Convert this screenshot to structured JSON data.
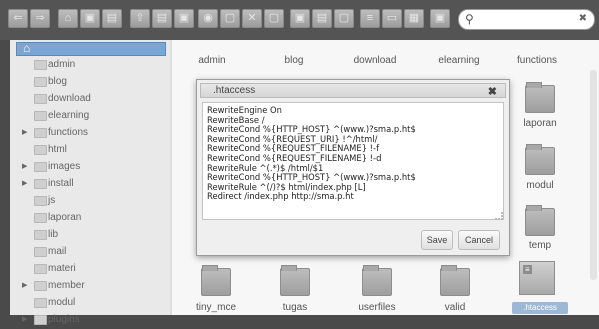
{
  "toolbar": {
    "buttons": [
      "back-icon",
      "forward-icon",
      "home-icon",
      "save-icon",
      "disk-icon",
      "upload-icon",
      "download-icon",
      "view-icon",
      "eye-icon",
      "cut-icon",
      "delete-icon",
      "rename-icon",
      "copy-icon",
      "paste-icon",
      "edit-icon",
      "settings-icon",
      "list-icon",
      "grid-icon",
      "info-icon"
    ],
    "search_value": ""
  },
  "sidebar": {
    "items": [
      {
        "label": "admin",
        "expandable": false
      },
      {
        "label": "blog",
        "expandable": false
      },
      {
        "label": "download",
        "expandable": false
      },
      {
        "label": "elearning",
        "expandable": false
      },
      {
        "label": "functions",
        "expandable": true
      },
      {
        "label": "html",
        "expandable": false
      },
      {
        "label": "images",
        "expandable": true
      },
      {
        "label": "install",
        "expandable": true
      },
      {
        "label": "js",
        "expandable": false
      },
      {
        "label": "laporan",
        "expandable": false
      },
      {
        "label": "lib",
        "expandable": false
      },
      {
        "label": "mail",
        "expandable": false
      },
      {
        "label": "materi",
        "expandable": false
      },
      {
        "label": "member",
        "expandable": true
      },
      {
        "label": "modul",
        "expandable": false
      },
      {
        "label": "plugins",
        "expandable": true
      }
    ]
  },
  "main": {
    "top_labels": [
      "admin",
      "blog",
      "download",
      "elearning",
      "functions"
    ],
    "right_labels": [
      "laporan",
      "modul",
      "temp"
    ],
    "bottom_labels": [
      "tiny_mce",
      "tugas",
      "userfiles",
      "valid"
    ],
    "selected_file": ".htaccess"
  },
  "dialog": {
    "title": ".htaccess",
    "close": "✖",
    "content": "RewriteEngine On\nRewriteBase /\nRewriteCond %{HTTP_HOST} ^(www.)?sma.p.ht$\nRewriteCond %{REQUEST_URI} !^/html/\nRewriteCond %{REQUEST_FILENAME} !-f\nRewriteCond %{REQUEST_FILENAME} !-d\nRewriteRule ^(.*)$ /html/$1\nRewriteCond %{HTTP_HOST} ^(www.)?sma.p.ht$\nRewriteRule ^(/)?$ html/index.php [L]\nRedirect /index.php http://sma.p.ht",
    "save_label": "Save",
    "cancel_label": "Cancel"
  }
}
